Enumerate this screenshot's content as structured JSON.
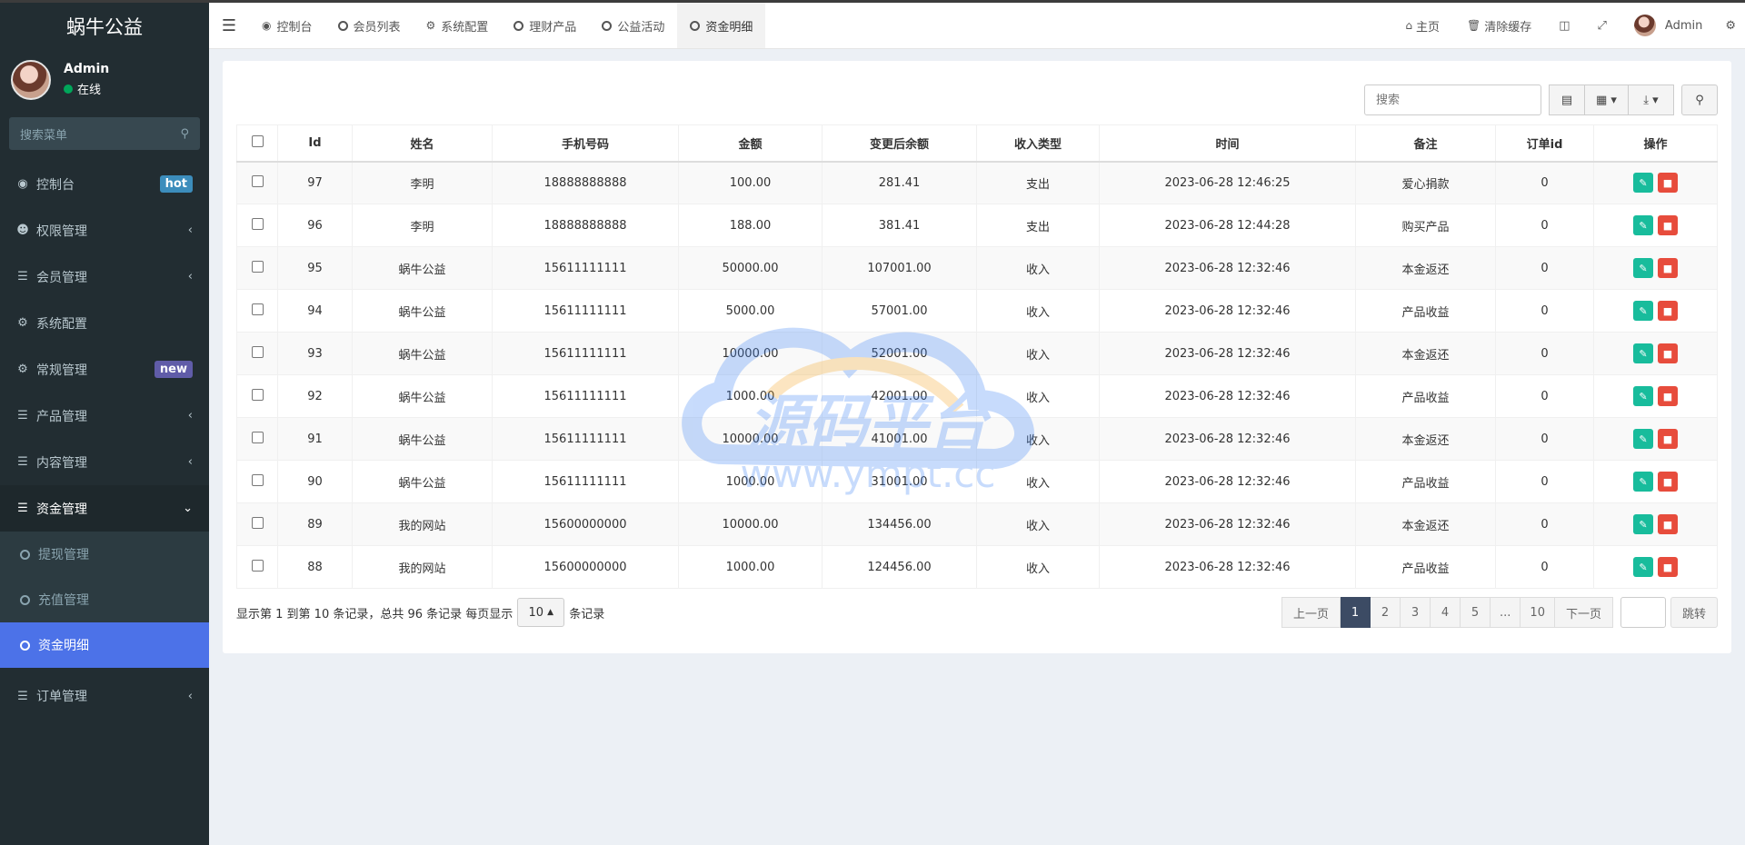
{
  "sidebar": {
    "brand": "蜗牛公益",
    "user": {
      "name": "Admin",
      "status": "在线"
    },
    "search_placeholder": "搜索菜单",
    "items": [
      {
        "label": "控制台",
        "badge": "hot"
      },
      {
        "label": "权限管理"
      },
      {
        "label": "会员管理"
      },
      {
        "label": "系统配置"
      },
      {
        "label": "常规管理",
        "badge": "new"
      },
      {
        "label": "产品管理"
      },
      {
        "label": "内容管理"
      },
      {
        "label": "资金管理"
      },
      {
        "label": "订单管理"
      }
    ],
    "submenu": [
      {
        "label": "提现管理"
      },
      {
        "label": "充值管理"
      },
      {
        "label": "资金明细"
      }
    ]
  },
  "header": {
    "tabs": [
      {
        "label": "控制台"
      },
      {
        "label": "会员列表"
      },
      {
        "label": "系统配置"
      },
      {
        "label": "理财产品"
      },
      {
        "label": "公益活动"
      },
      {
        "label": "资金明细"
      }
    ],
    "right": {
      "home": "主页",
      "clear_cache": "清除缓存",
      "user": "Admin"
    }
  },
  "toolbar": {
    "search_placeholder": "搜索"
  },
  "table": {
    "columns": [
      "Id",
      "姓名",
      "手机号码",
      "金额",
      "变更后余额",
      "收入类型",
      "时间",
      "备注",
      "订单id",
      "操作"
    ],
    "rows": [
      {
        "id": "97",
        "name": "李明",
        "phone": "18888888888",
        "amount": "100.00",
        "balance": "281.41",
        "type": "支出",
        "time": "2023-06-28 12:46:25",
        "remark": "爱心捐款",
        "order": "0"
      },
      {
        "id": "96",
        "name": "李明",
        "phone": "18888888888",
        "amount": "188.00",
        "balance": "381.41",
        "type": "支出",
        "time": "2023-06-28 12:44:28",
        "remark": "购买产品",
        "order": "0"
      },
      {
        "id": "95",
        "name": "蜗牛公益",
        "phone": "15611111111",
        "amount": "50000.00",
        "balance": "107001.00",
        "type": "收入",
        "time": "2023-06-28 12:32:46",
        "remark": "本金返还",
        "order": "0"
      },
      {
        "id": "94",
        "name": "蜗牛公益",
        "phone": "15611111111",
        "amount": "5000.00",
        "balance": "57001.00",
        "type": "收入",
        "time": "2023-06-28 12:32:46",
        "remark": "产品收益",
        "order": "0"
      },
      {
        "id": "93",
        "name": "蜗牛公益",
        "phone": "15611111111",
        "amount": "10000.00",
        "balance": "52001.00",
        "type": "收入",
        "time": "2023-06-28 12:32:46",
        "remark": "本金返还",
        "order": "0"
      },
      {
        "id": "92",
        "name": "蜗牛公益",
        "phone": "15611111111",
        "amount": "1000.00",
        "balance": "42001.00",
        "type": "收入",
        "time": "2023-06-28 12:32:46",
        "remark": "产品收益",
        "order": "0"
      },
      {
        "id": "91",
        "name": "蜗牛公益",
        "phone": "15611111111",
        "amount": "10000.00",
        "balance": "41001.00",
        "type": "收入",
        "time": "2023-06-28 12:32:46",
        "remark": "本金返还",
        "order": "0"
      },
      {
        "id": "90",
        "name": "蜗牛公益",
        "phone": "15611111111",
        "amount": "1000.00",
        "balance": "31001.00",
        "type": "收入",
        "time": "2023-06-28 12:32:46",
        "remark": "产品收益",
        "order": "0"
      },
      {
        "id": "89",
        "name": "我的网站",
        "phone": "15600000000",
        "amount": "10000.00",
        "balance": "134456.00",
        "type": "收入",
        "time": "2023-06-28 12:32:46",
        "remark": "本金返还",
        "order": "0"
      },
      {
        "id": "88",
        "name": "我的网站",
        "phone": "15600000000",
        "amount": "1000.00",
        "balance": "124456.00",
        "type": "收入",
        "time": "2023-06-28 12:32:46",
        "remark": "产品收益",
        "order": "0"
      }
    ]
  },
  "footer": {
    "info_prefix": "显示第 1 到第 10 条记录，总共 96 条记录 每页显示",
    "page_size": "10",
    "info_suffix": "条记录"
  },
  "pagination": {
    "prev": "上一页",
    "pages": [
      "1",
      "2",
      "3",
      "4",
      "5",
      "...",
      "10"
    ],
    "next": "下一页",
    "jump": "跳转"
  },
  "watermark": {
    "title": "源码平台",
    "url": "www.ympt.cc"
  },
  "colors": {
    "sidebar_bg": "#222d32",
    "active_blue": "#4c72e8",
    "income_green": "#18bc9c",
    "delete_red": "#e74c3c"
  }
}
